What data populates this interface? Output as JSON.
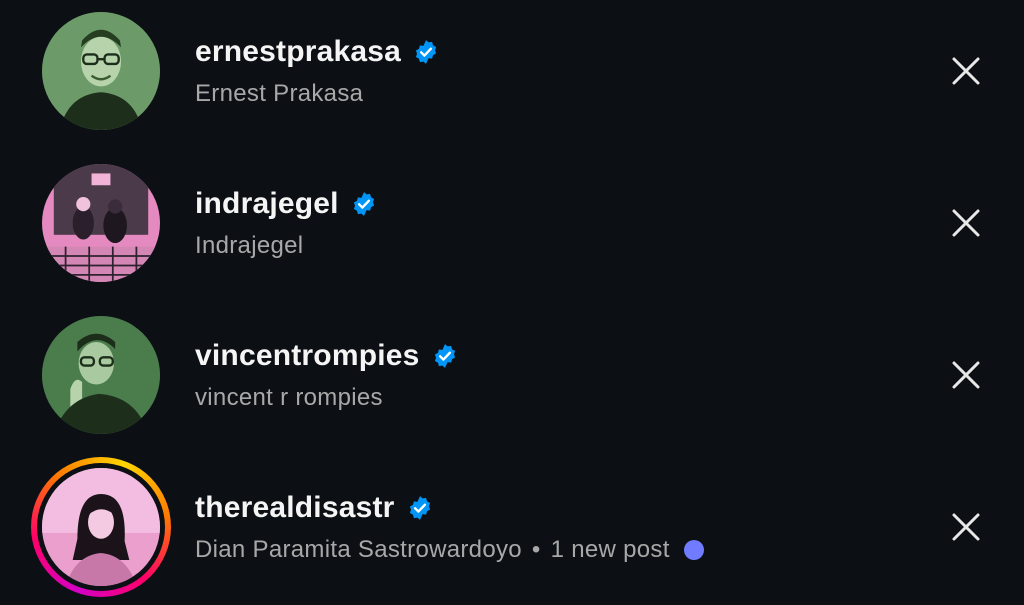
{
  "accounts": [
    {
      "username": "ernestprakasa",
      "full_name": "Ernest Prakasa",
      "verified": true,
      "avatar_icon": "profile-photo-green-duotone"
    },
    {
      "username": "indrajegel",
      "full_name": "Indrajegel",
      "verified": true,
      "avatar_icon": "profile-photo-pink-duotone"
    },
    {
      "username": "vincentrompies",
      "full_name": "vincent r rompies",
      "verified": true,
      "avatar_icon": "profile-photo-green-duotone"
    },
    {
      "username": "therealdisastr",
      "full_name": "Dian Paramita Sastrowardoyo",
      "verified": true,
      "separator": "•",
      "status": "1 new post",
      "has_story": true,
      "avatar_icon": "profile-photo-pink-duotone"
    }
  ],
  "icons": {
    "verified": "verified-badge-icon",
    "dismiss": "close-icon",
    "new_post": "new-post-dot-icon"
  },
  "colors": {
    "background": "#0c1014",
    "verified_blue": "#0095f6",
    "secondary_text": "#a8a8a8",
    "new_post_dot": "#6f7cff",
    "green_duotone": "#4e8a52",
    "pink_duotone": "#e48ac0"
  }
}
